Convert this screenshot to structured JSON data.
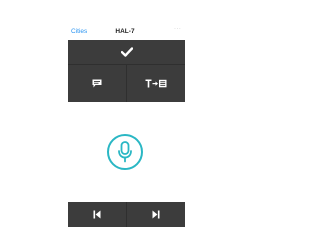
{
  "nav": {
    "back_label": "Cities",
    "title": "HAL-7",
    "more_label": "..."
  },
  "controls": {
    "confirm_icon": "checkmark-icon",
    "chat_icon": "chat-bubble-icon",
    "text_to_text_icon": "text-to-text-icon"
  },
  "voice": {
    "mic_icon": "microphone-icon",
    "accent_color": "#2ab7c4"
  },
  "media": {
    "previous_icon": "skip-previous-icon",
    "next_icon": "skip-next-icon"
  },
  "colors": {
    "link": "#2b95f2",
    "panel": "#2f2f2f",
    "button": "#3c3c3c",
    "icon": "#ffffff"
  }
}
